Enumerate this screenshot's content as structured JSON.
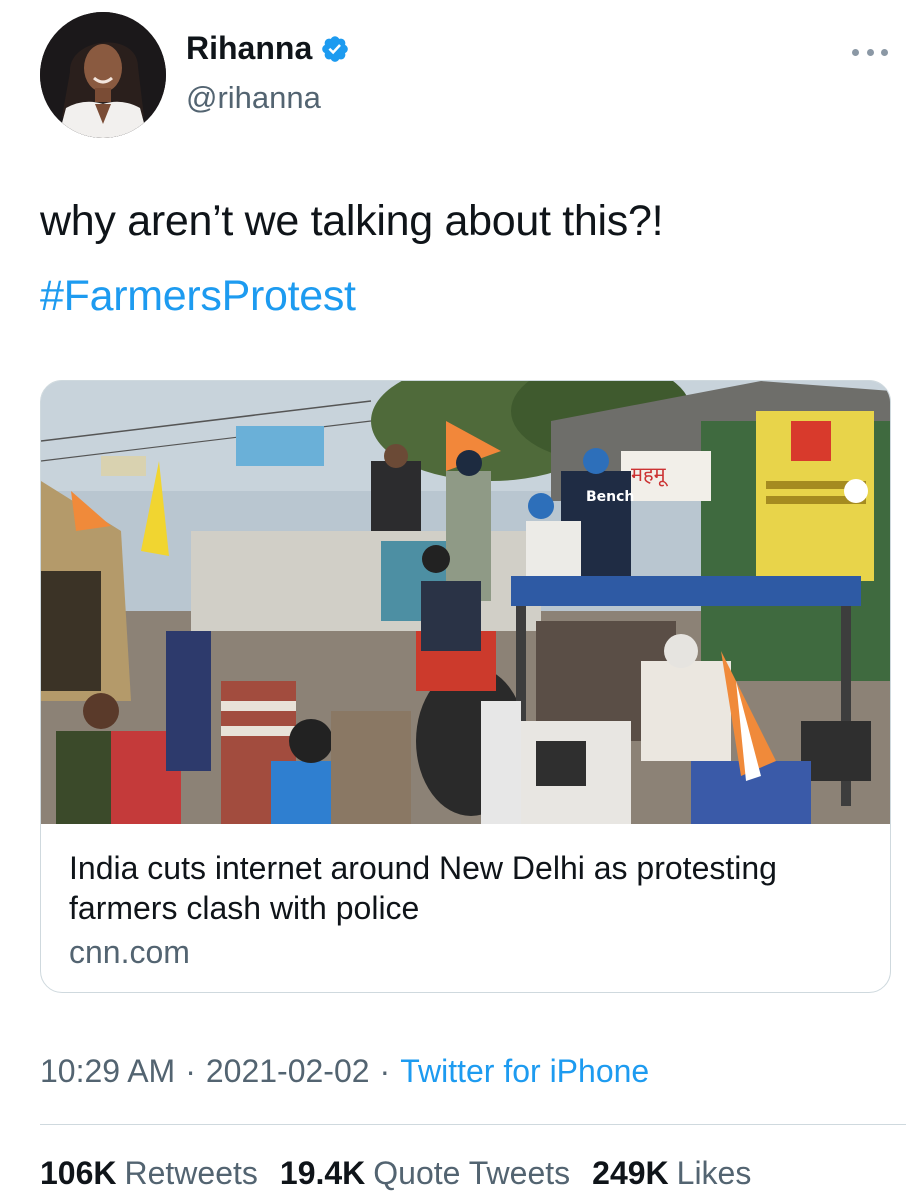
{
  "author": {
    "display_name": "Rihanna",
    "handle": "@rihanna",
    "verified": true,
    "avatar_icon": "profile-photo"
  },
  "tweet": {
    "text": "why aren’t we talking about this?!",
    "hashtag": "#FarmersProtest"
  },
  "card": {
    "title": "India cuts internet around New Delhi as protesting farmers clash with police",
    "domain": "cnn.com",
    "image_sign_text": "Bench",
    "image_banner_text": "महमू"
  },
  "meta": {
    "time": "10:29 AM",
    "separator": "·",
    "date": "2021-02-02",
    "source": "Twitter for iPhone"
  },
  "stats": {
    "retweets_count": "106K",
    "retweets_label": "Retweets",
    "quotes_count": "19.4K",
    "quotes_label": "Quote Tweets",
    "likes_count": "249K",
    "likes_label": "Likes"
  },
  "colors": {
    "link_blue": "#1d9bf0",
    "secondary_gray": "#536471",
    "border": "#cfd9de"
  }
}
